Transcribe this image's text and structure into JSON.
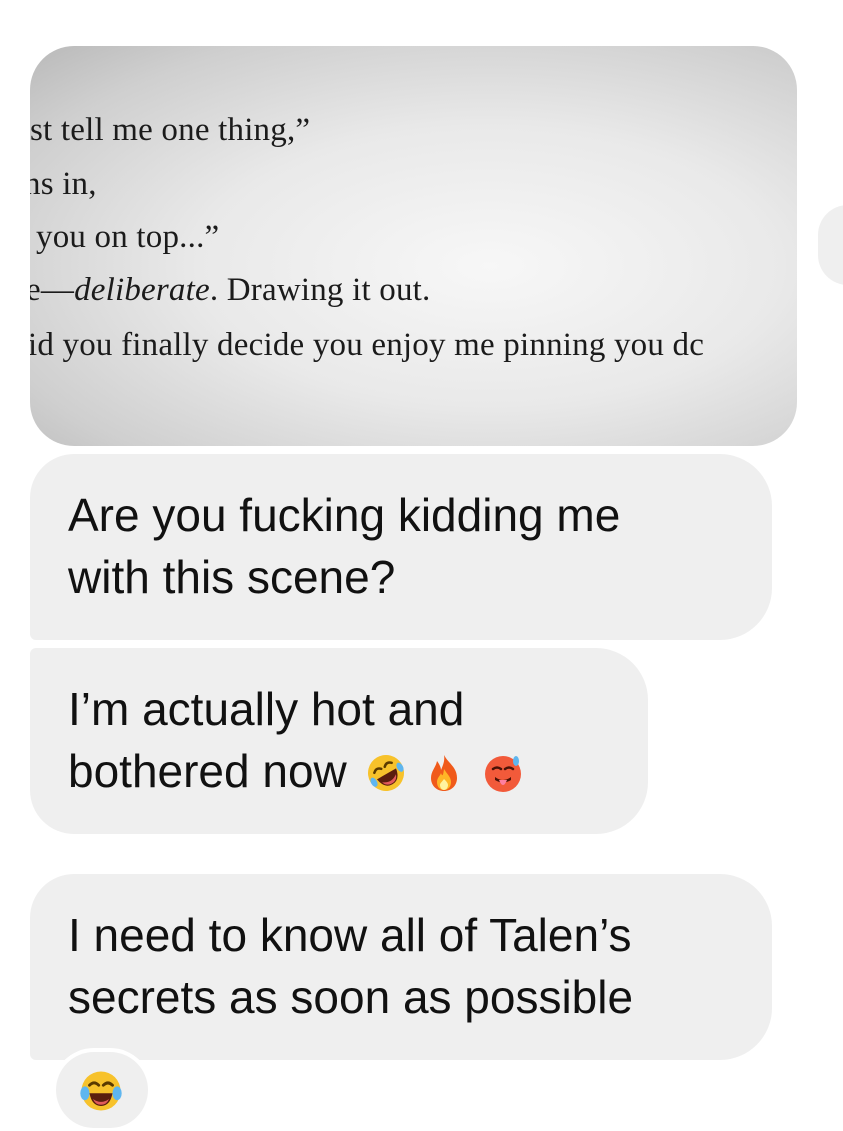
{
  "photo": {
    "lines": [
      {
        "text": "st tell me one thing,”"
      },
      {
        "text": "ns in,"
      },
      {
        "text": "you on top...”"
      },
      {
        "prefix": "e—",
        "italic": "deliberate",
        "suffix": ". Drawing it out."
      },
      {
        "text": "id you finally decide you enjoy me pinning you dc"
      }
    ]
  },
  "messages": [
    {
      "line1": "Are you fucking kidding me",
      "line2": "with this scene?"
    },
    {
      "line1": "I’m actually hot and",
      "line2": "bothered now",
      "emojis": [
        "rolling-on-floor-laughing-emoji",
        "fire-emoji",
        "hot-face-emoji"
      ]
    },
    {
      "line1": "I need to know all of Talen’s",
      "line2": "secrets as soon as possible"
    }
  ],
  "reaction": {
    "emoji": "tears-of-joy-emoji"
  },
  "colors": {
    "bubble": "#efefef",
    "text": "#111111",
    "background": "#ffffff"
  }
}
